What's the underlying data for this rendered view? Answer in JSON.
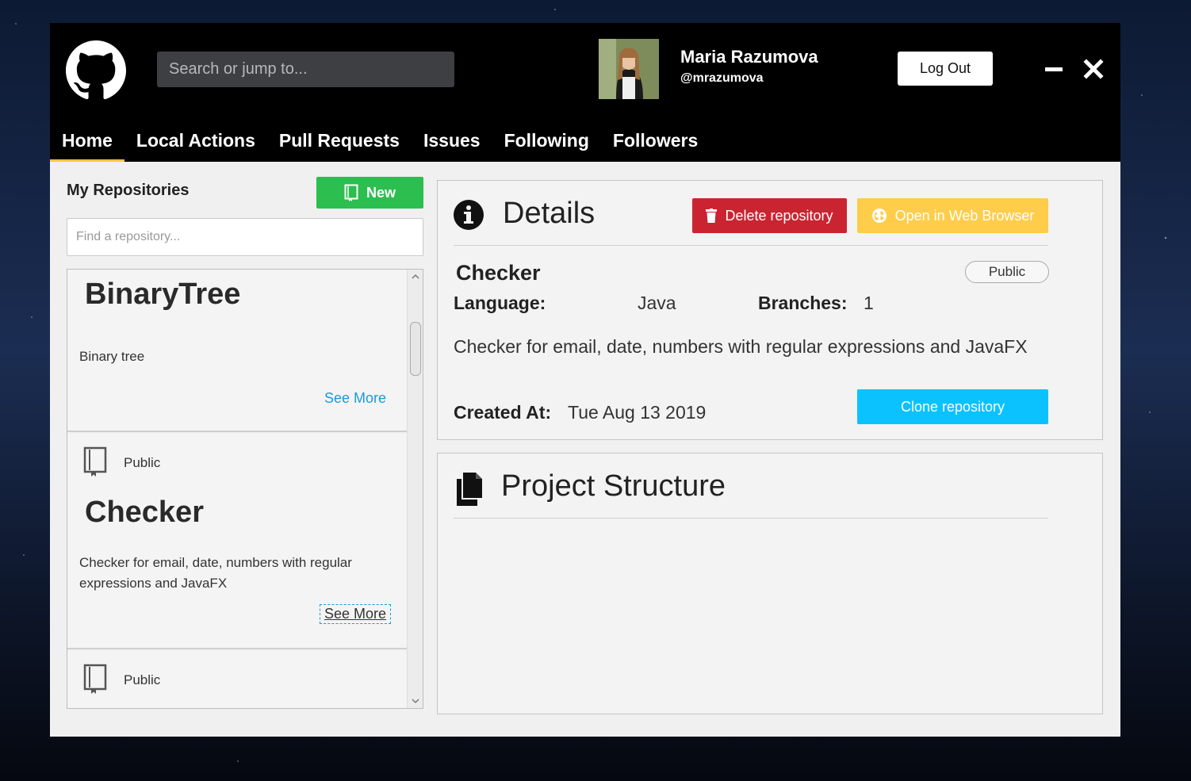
{
  "header": {
    "search_placeholder": "Search or jump to...",
    "user_name": "Maria Razumova",
    "user_handle": "@mrazumova",
    "logout_label": "Log Out"
  },
  "nav": {
    "tabs": [
      {
        "label": "Home",
        "active": true
      },
      {
        "label": "Local Actions"
      },
      {
        "label": "Pull Requests"
      },
      {
        "label": "Issues"
      },
      {
        "label": "Following"
      },
      {
        "label": "Followers"
      }
    ]
  },
  "repos": {
    "title": "My Repositories",
    "new_label": "New",
    "find_placeholder": "Find a repository...",
    "items": [
      {
        "name": "BinaryTree",
        "description": "Binary tree",
        "see_more": "See More"
      },
      {
        "visibility": "Public",
        "name": "Checker",
        "description": "Checker for email, date, numbers with regular expressions and JavaFX",
        "see_more": "See More"
      },
      {
        "visibility": "Public"
      }
    ]
  },
  "details": {
    "title": "Details",
    "delete_label": "Delete repository",
    "browser_label": "Open in Web Browser",
    "name": "Checker",
    "visibility": "Public",
    "language_label": "Language:",
    "language": "Java",
    "branches_label": "Branches:",
    "branches": "1",
    "description": "Checker for email, date, numbers with regular expressions and JavaFX",
    "created_label": "Created At:",
    "created": "Tue Aug 13 2019",
    "clone_label": "Clone repository"
  },
  "structure": {
    "title": "Project Structure"
  },
  "colors": {
    "new": "#2cbe4e",
    "delete": "#cb2431",
    "browser": "#ffcd4a",
    "clone": "#0bc2ff",
    "tab_underline": "#f5c542"
  }
}
